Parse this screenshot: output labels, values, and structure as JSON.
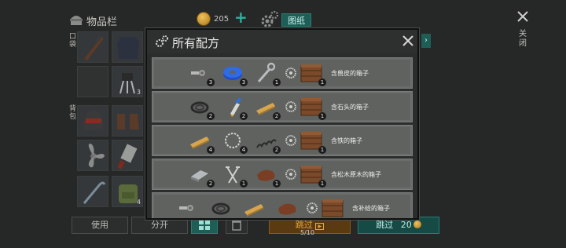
{
  "inventory": {
    "title": "物品栏",
    "coins": "205",
    "blueprint_tab": "图纸",
    "close_label": "关闭",
    "section_labels": [
      "口袋",
      "背包"
    ],
    "slot_counts": [
      "3",
      "4"
    ]
  },
  "bottom_bar": {
    "use_label": "使用",
    "split_label": "分开",
    "skip_ad_label": "跳过",
    "skip_ad_counter": "5/10",
    "skip_paid_label": "跳过",
    "skip_paid_cost": "20"
  },
  "modal": {
    "title": "所有配方",
    "recipes": [
      {
        "ingredients": [
          {
            "icon": "nail-bolt-icon",
            "count": "3"
          },
          {
            "icon": "duct-tape-icon",
            "count": "3"
          },
          {
            "icon": "wrench-icon",
            "count": "1"
          }
        ],
        "result": {
          "icon": "crate-icon",
          "count": "1",
          "label": "含兽皮的箱子"
        }
      },
      {
        "ingredients": [
          {
            "icon": "rope-coil-icon",
            "count": "2"
          },
          {
            "icon": "glue-icon",
            "count": "2"
          },
          {
            "icon": "wood-plank-icon",
            "count": "2"
          }
        ],
        "result": {
          "icon": "crate-icon",
          "count": "1",
          "label": "含石头的箱子"
        }
      },
      {
        "ingredients": [
          {
            "icon": "wood-plank-icon",
            "count": "4"
          },
          {
            "icon": "chain-ring-icon",
            "count": "4"
          },
          {
            "icon": "spring-icon",
            "count": "2"
          }
        ],
        "result": {
          "icon": "crate-icon",
          "count": "1",
          "label": "含铁的箱子"
        }
      },
      {
        "ingredients": [
          {
            "icon": "metal-bar-icon",
            "count": "2"
          },
          {
            "icon": "nails-icon",
            "count": "1"
          },
          {
            "icon": "leather-icon",
            "count": "1"
          }
        ],
        "result": {
          "icon": "crate-icon",
          "count": "1",
          "label": "含松木原木的箱子"
        }
      },
      {
        "ingredients": [
          {
            "icon": "nail-bolt-icon",
            "count": ""
          },
          {
            "icon": "rope-coil-icon",
            "count": ""
          },
          {
            "icon": "wood-plank-icon",
            "count": ""
          },
          {
            "icon": "leather-icon",
            "count": ""
          }
        ],
        "result": {
          "icon": "crate-icon",
          "count": "",
          "label": "含补给的箱子"
        }
      }
    ]
  },
  "colors": {
    "teal_accent": "#1e5e57",
    "orange_accent": "#8b5a18",
    "row_bg": "#5f625f",
    "modal_bg": "#2b2d2c"
  }
}
